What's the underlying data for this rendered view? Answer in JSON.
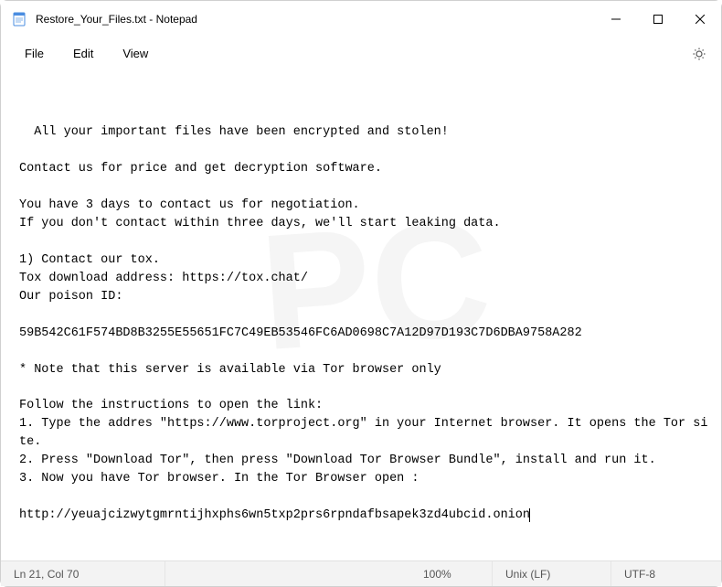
{
  "window": {
    "title": "Restore_Your_Files.txt - Notepad"
  },
  "menu": {
    "file": "File",
    "edit": "Edit",
    "view": "View"
  },
  "content": {
    "body": "All your important files have been encrypted and stolen!\n\nContact us for price and get decryption software.\n\nYou have 3 days to contact us for negotiation.\nIf you don't contact within three days, we'll start leaking data.\n\n1) Contact our tox.\nTox download address: https://tox.chat/\nOur poison ID:\n\n59B542C61F574BD8B3255E55651FC7C49EB53546FC6AD0698C7A12D97D193C7D6DBA9758A282\n\n* Note that this server is available via Tor browser only\n\nFollow the instructions to open the link:\n1. Type the addres \"https://www.torproject.org\" in your Internet browser. It opens the Tor site.\n2. Press \"Download Tor\", then press \"Download Tor Browser Bundle\", install and run it.\n3. Now you have Tor browser. In the Tor Browser open :\n\nhttp://yeuajcizwytgmrntijhxphs6wn5txp2prs6rpndafbsapek3zd4ubcid.onion"
  },
  "status": {
    "cursor": "Ln 21, Col 70",
    "zoom": "100%",
    "eol": "Unix (LF)",
    "encoding": "UTF-8"
  }
}
